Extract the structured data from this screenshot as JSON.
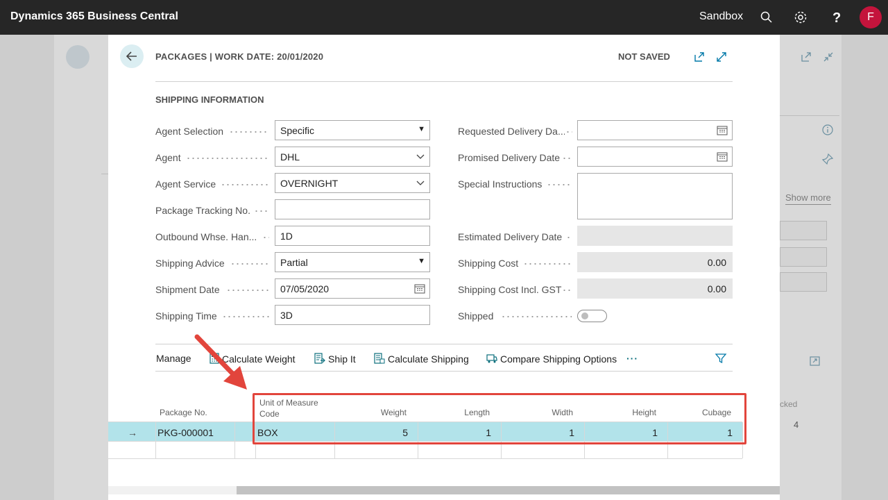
{
  "app": {
    "title": "Dynamics 365 Business Central",
    "environment": "Sandbox",
    "avatar_initial": "F"
  },
  "background": {
    "show_more": "Show more",
    "col_packed_partial": "cked",
    "packed_value": "4"
  },
  "dialog": {
    "title": "PACKAGES | WORK DATE: 20/01/2020",
    "status": "NOT SAVED",
    "section": "SHIPPING INFORMATION",
    "left_fields": [
      {
        "label": "Agent Selection",
        "value": "Specific"
      },
      {
        "label": "Agent",
        "value": "DHL"
      },
      {
        "label": "Agent Service",
        "value": "OVERNIGHT"
      },
      {
        "label": "Package Tracking No.",
        "value": ""
      },
      {
        "label": "Outbound Whse. Han...",
        "value": "1D"
      },
      {
        "label": "Shipping Advice",
        "value": "Partial"
      },
      {
        "label": "Shipment Date",
        "value": "07/05/2020"
      },
      {
        "label": "Shipping Time",
        "value": "3D"
      }
    ],
    "right_fields": [
      {
        "label": "Requested Delivery Da...",
        "value": ""
      },
      {
        "label": "Promised Delivery Date",
        "value": ""
      },
      {
        "label": "Special Instructions",
        "value": ""
      },
      {
        "label": "Estimated Delivery Date",
        "value": ""
      },
      {
        "label": "Shipping Cost",
        "value": "0.00"
      },
      {
        "label": "Shipping Cost Incl. GST",
        "value": "0.00"
      },
      {
        "label": "Shipped",
        "value": false
      }
    ],
    "actions": {
      "manage": "Manage",
      "calculate_weight": "Calculate Weight",
      "ship_it": "Ship It",
      "calculate_shipping": "Calculate Shipping",
      "compare_shipping": "Compare Shipping Options",
      "more": "···"
    },
    "grid": {
      "headers": {
        "package_no": "Package No.",
        "uom_line1": "Unit of Measure",
        "uom_line2": "Code",
        "weight": "Weight",
        "length": "Length",
        "width": "Width",
        "height": "Height",
        "cubage": "Cubage"
      },
      "rows": [
        {
          "package_no": "PKG-000001",
          "uom": "BOX",
          "weight": "5",
          "length": "1",
          "width": "1",
          "height": "1",
          "cubage": "1"
        }
      ]
    }
  },
  "colors": {
    "appbar": "#262626",
    "accent": "#00a0b5",
    "selected_row": "#b2e3ea",
    "highlight": "#e2453c",
    "avatar": "#c4143c"
  }
}
